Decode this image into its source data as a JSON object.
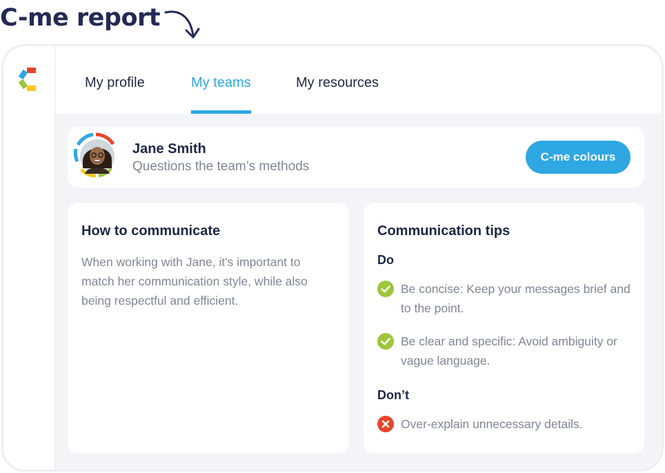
{
  "report_title": "C-me report",
  "nav": {
    "tabs": [
      {
        "label": "My profile"
      },
      {
        "label": "My teams"
      },
      {
        "label": "My resources"
      }
    ],
    "active_tab": "My teams"
  },
  "profile": {
    "name": "Jane Smith",
    "description": "Questions the team’s methods",
    "button_label": "C-me colours"
  },
  "communicate": {
    "title": "How to communicate",
    "body": "When working with Jane, it's important to match her communication style, while also being respectful and efficient."
  },
  "tips": {
    "title": "Communication tips",
    "do_label": "Do",
    "do_items": [
      "Be concise: Keep your messages brief and to the point.",
      "Be clear and specific: Avoid ambiguity or vague language."
    ],
    "dont_label": "Don’t",
    "dont_items": [
      "Over-explain unnecessary details."
    ]
  },
  "colors": {
    "accent": "#2ea7e3",
    "do_icon": "#9cc63b",
    "dont_icon": "#e8452c",
    "logo_red": "#e8452c",
    "logo_blue": "#2ea7e3",
    "logo_green": "#9cc63b",
    "logo_yellow": "#f7c81e"
  },
  "icons": {
    "logo": "c-me-logo-icon",
    "arrow": "curved-arrow-icon",
    "do": "check-circle-icon",
    "dont": "x-circle-icon"
  }
}
